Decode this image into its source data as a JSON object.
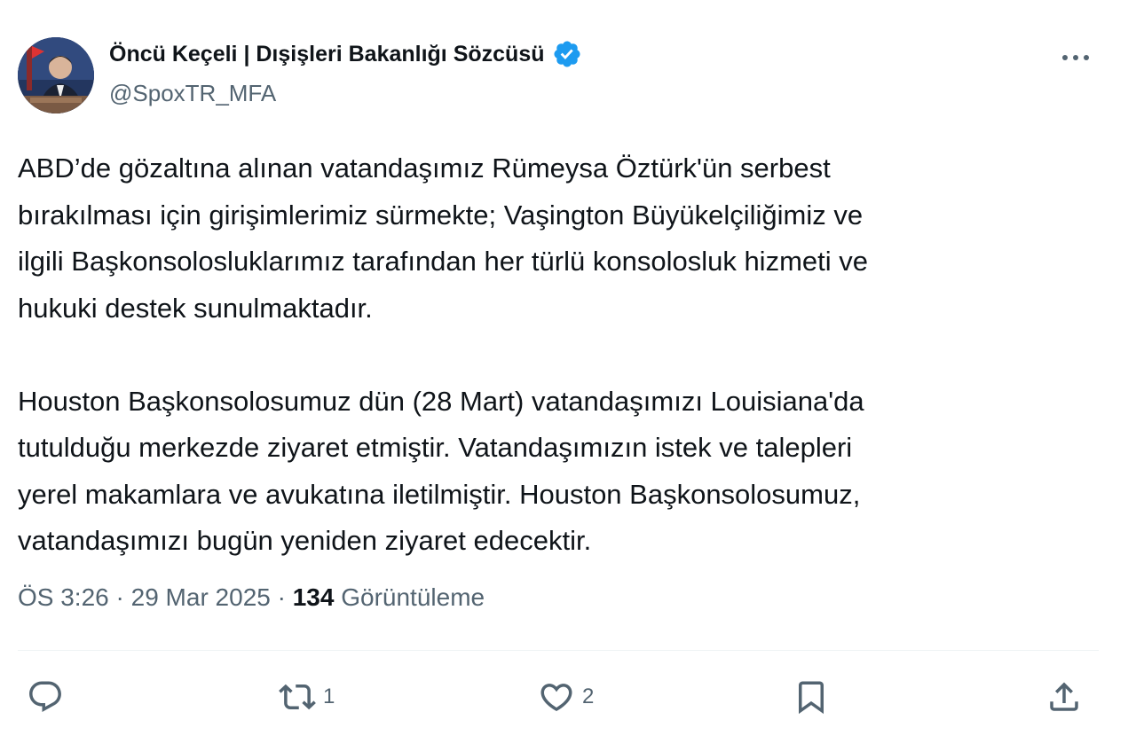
{
  "author": {
    "display_name": "Öncü Keçeli | Dışişleri Bakanlığı Sözcüsü",
    "handle": "@SpoxTR_MFA",
    "verified_icon": "verified-badge-icon",
    "avatar_icon": "avatar"
  },
  "tweet": {
    "paragraph1": [
      "ABD’de gözaltına alınan vatandaşımız Rümeysa Öztürk'ün serbest",
      "bırakılması için girişimlerimiz sürmekte; Vaşington Büyükelçiliğimiz ve",
      "ilgili Başkonsolosluklarımız tarafından her türlü konsolosluk hizmeti ve",
      "hukuki destek sunulmaktadır."
    ],
    "paragraph2": [
      "Houston Başkonsolosumuz dün (28 Mart) vatandaşımızı Louisiana'da",
      "tutulduğu merkezde ziyaret etmiştir. Vatandaşımızın istek ve talepleri",
      "yerel makamlara ve avukatına iletilmiştir. Houston Başkonsolosumuz,",
      "vatandaşımızı bugün yeniden ziyaret edecektir."
    ]
  },
  "meta": {
    "time": "ÖS 3:26",
    "separator": "·",
    "date": "29 Mar 2025",
    "views_count": "134",
    "views_label": "Görüntüleme"
  },
  "actions": {
    "reply": {
      "icon": "reply-icon",
      "count": ""
    },
    "retweet": {
      "icon": "retweet-icon",
      "count": "1"
    },
    "like": {
      "icon": "heart-icon",
      "count": "2"
    },
    "bookmark": {
      "icon": "bookmark-icon",
      "count": ""
    },
    "share": {
      "icon": "share-icon",
      "count": ""
    }
  },
  "colors": {
    "text_primary": "#0f1419",
    "text_secondary": "#536471",
    "verified_blue": "#1d9bf0",
    "divider": "#eff3f4"
  }
}
